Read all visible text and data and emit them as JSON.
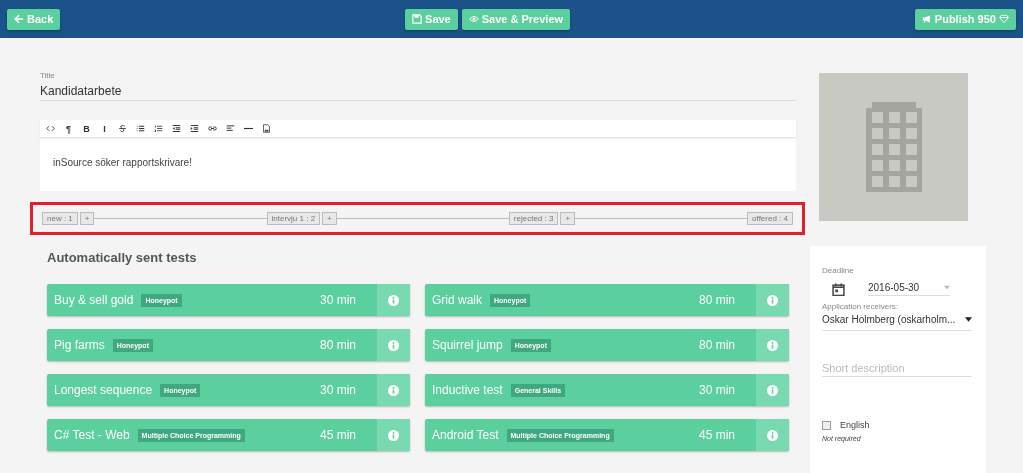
{
  "header": {
    "back": "Back",
    "save": "Save",
    "preview": "Save & Preview",
    "publish": "Publish 950"
  },
  "title_field": {
    "label": "Title",
    "value": "Kandidatarbete"
  },
  "editor": {
    "toolbar": [
      {
        "kind": "code"
      },
      {
        "kind": "glyph",
        "text": "¶"
      },
      {
        "kind": "glyph",
        "text": "B"
      },
      {
        "kind": "glyph",
        "text": "I"
      },
      {
        "kind": "strike"
      },
      {
        "kind": "bullets"
      },
      {
        "kind": "numbers"
      },
      {
        "kind": "outdent"
      },
      {
        "kind": "indent"
      },
      {
        "kind": "link"
      },
      {
        "kind": "align"
      },
      {
        "kind": "rule"
      },
      {
        "kind": "image"
      }
    ],
    "content": "inSource söker rapportskrivare!"
  },
  "pipeline": {
    "highlighted": true,
    "stages": [
      {
        "label": "new : 1",
        "add": "+"
      },
      {
        "label": "intervju 1 : 2",
        "add": "+"
      },
      {
        "label": "rejected : 3",
        "add": "+"
      },
      {
        "label": "offered : 4"
      }
    ]
  },
  "tests": {
    "heading": "Automatically sent tests",
    "items": [
      {
        "name": "Buy & sell gold",
        "tag": "Honeypot",
        "duration": "30 min"
      },
      {
        "name": "Grid walk",
        "tag": "Honeypot",
        "duration": "80 min"
      },
      {
        "name": "Pig farms",
        "tag": "Honeypot",
        "duration": "80 min"
      },
      {
        "name": "Squirrel jump",
        "tag": "Honeypot",
        "duration": "80 min"
      },
      {
        "name": "Longest sequence",
        "tag": "Honeypot",
        "duration": "30 min"
      },
      {
        "name": "Inductive test",
        "tag": "General Skills",
        "duration": "30 min"
      },
      {
        "name": "C# Test - Web",
        "tag": "Multiple Choice Programming",
        "duration": "45 min"
      },
      {
        "name": "Android Test",
        "tag": "Multiple Choice Programming",
        "duration": "45 min"
      }
    ]
  },
  "sidebar": {
    "deadline_label": "Deadline",
    "deadline": "2016-05-30",
    "receivers_label": "Application receivers:",
    "receivers": "Oskar Holmberg (oskarholm...",
    "short_description_placeholder": "Short description",
    "language": {
      "label": "English",
      "checked": false
    },
    "note": "Not required"
  }
}
